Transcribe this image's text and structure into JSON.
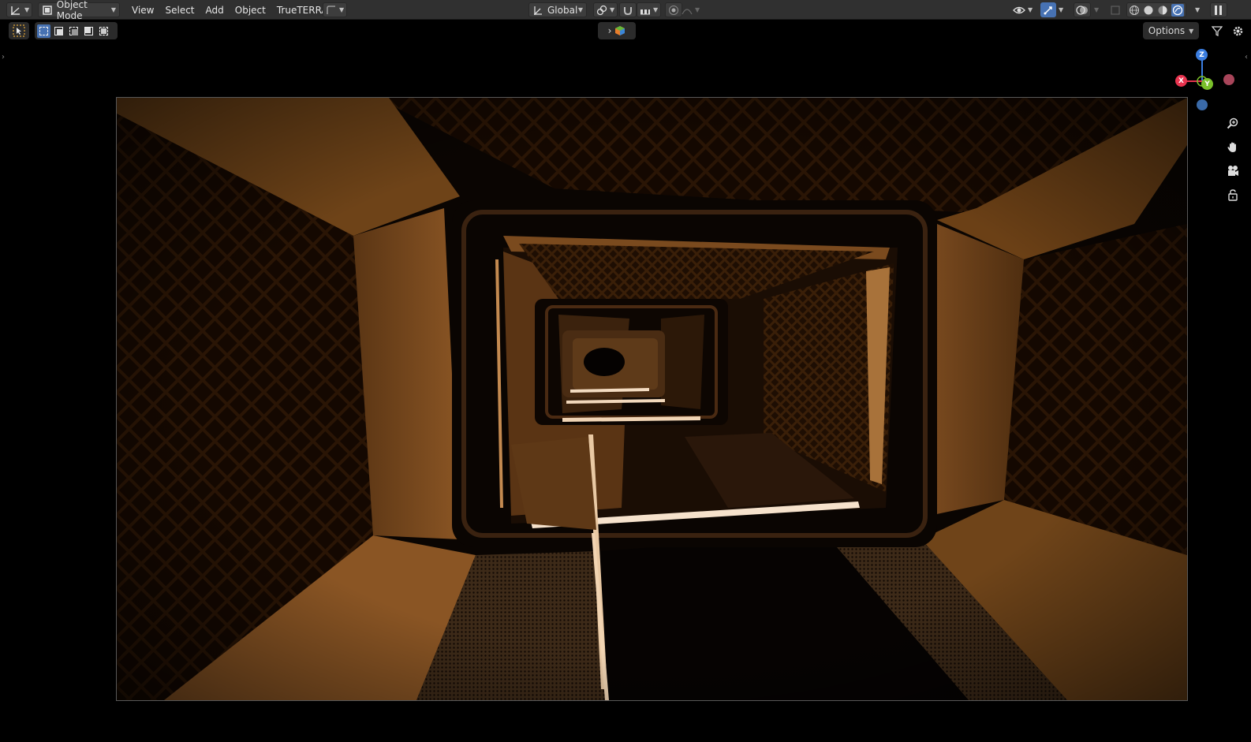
{
  "header": {
    "editor_type_icon": "transform-gizmo-icon",
    "mode": {
      "label": "Object Mode",
      "icon": "object-mode-icon"
    },
    "menus": [
      "View",
      "Select",
      "Add",
      "Object",
      "TrueTERRAIN"
    ],
    "transform_orientation": {
      "label": "Global",
      "icon": "orientation-icon"
    },
    "right_icons": [
      "visibility-icon",
      "gizmo-icon",
      "overlay-icon",
      "xray-icon",
      "wireframe-shading-icon",
      "solid-shading-icon",
      "material-shading-icon",
      "rendered-shading-icon",
      "pause-icon"
    ]
  },
  "toolrow": {
    "options_label": "Options",
    "selection_modes": [
      "select-new",
      "select-extend",
      "select-subtract",
      "select-invert",
      "select-intersect"
    ]
  },
  "gizmo": {
    "x_label": "X",
    "y_label": "Y",
    "z_label": "Z",
    "colors": {
      "x": "#e8344f",
      "y": "#7ac02a",
      "z": "#3a7de0"
    }
  },
  "navigation": [
    "zoom-icon",
    "pan-hand-icon",
    "camera-icon",
    "lock-icon"
  ],
  "viewport": {
    "scene": "camera view down a corridor with lit orange walls"
  }
}
